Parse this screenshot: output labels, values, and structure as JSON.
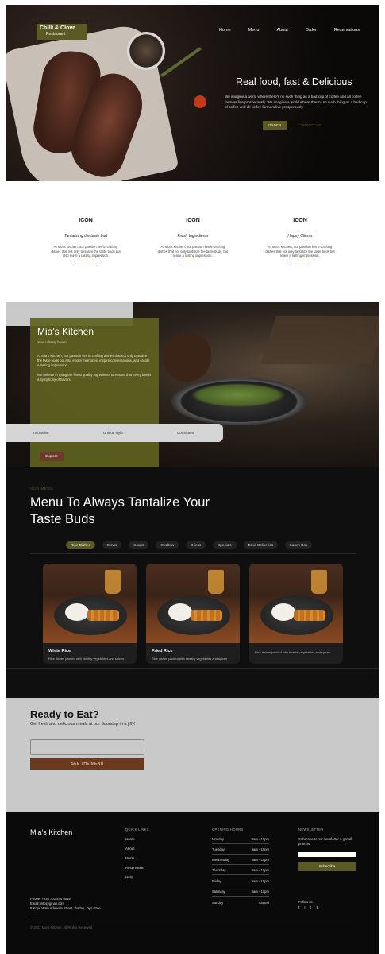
{
  "hero": {
    "brand": "Chilli & Clove",
    "brand_sub": "Restaurant",
    "nav": [
      "Home",
      "Menu",
      "About",
      "Order",
      "Reservations"
    ],
    "title": "Real food, fast & Delicious",
    "lead": "We imagine a world where there's no such thing as a bad cup of coffee and all coffee farmers live prosperously. We imagine a world where there's no such thing as a bad cup of coffee and all coffee farmers live prosperously.",
    "order_label": "ORDER",
    "contact_label": "CONTACT US"
  },
  "features": [
    {
      "icon": "ICON",
      "title": "Tantalizing the taste bud",
      "text": "At Mia's Kitchen, our passion lies in crafting dishes that not only tantalize the taste buds but also leave a lasting impression."
    },
    {
      "icon": "ICON",
      "title": "Fresh Ingredients",
      "text": "At Mia's Kitchen, our passion lies in crafting dishes that not only tantalize the taste buds, but leave a lasting impression."
    },
    {
      "icon": "ICON",
      "title": "Happy Clients",
      "text": "At Mia's Kitchen, our passion lies in crafting dishes that not only tantalize the taste buds but leave a lasting impression."
    }
  ],
  "kitchen": {
    "title": "Mia's Kitchen",
    "tagline": "Your culinary haven",
    "p1": "At Mia's Kitchen, our passion lies in crafting dishes that not only tantalize the taste buds but also evoke memories, inspire conversations, and create a lasting impression.",
    "p2": "We believe in using the finest quality ingredients to ensure that every bite is a symphony of flavors.",
    "strip": [
      "Innovative",
      "Unique style",
      "Consistent"
    ],
    "explore_label": "Explore"
  },
  "menu": {
    "eyebrow": "OUR MENU",
    "title": "Menu To Always Tantalize Your Taste Buds",
    "tabs": [
      "Rice-Dishes",
      "Stews",
      "Soups",
      "Swallow",
      "Drinks",
      "Specials",
      "Bowl-Deliveries",
      "Lunch-Box"
    ],
    "cards": [
      {
        "title": "White Rice",
        "desc": "Rice dishes packed with healthy vegetables and spices"
      },
      {
        "title": "Fried Rice",
        "desc": "Rice dishes packed with healthy vegetables and spices"
      },
      {
        "title": "",
        "desc": "Rice dishes packed with healthy vegetables and spices"
      }
    ]
  },
  "ready": {
    "title": "Ready to Eat?",
    "subtitle": "Get fresh and delicious meals at our doorstep in a jiffy!",
    "input_placeholder": "",
    "button_label": "SEE THE MENU"
  },
  "footer": {
    "brand": "Mia's Kitchen",
    "quick_links_title": "QUICK LINKS",
    "quick_links": [
      "Home",
      "About",
      "Menu",
      "Reservation",
      "Help"
    ],
    "hours_title": "OPENING HOURS",
    "hours": [
      {
        "day": "Monday",
        "time": "9am - 10pm"
      },
      {
        "day": "Tuesday",
        "time": "9am - 10pm"
      },
      {
        "day": "Wednesday",
        "time": "9am - 10pm"
      },
      {
        "day": "Thursday",
        "time": "9am - 10pm"
      },
      {
        "day": "Friday",
        "time": "9am - 10pm"
      },
      {
        "day": "Saturday",
        "time": "9am - 10pm"
      },
      {
        "day": "Sunday",
        "time": "Closed"
      }
    ],
    "newsletter_title": "NEWSLETTER",
    "newsletter_text": "Subscribe to our newsletter & get all promos",
    "subscribe_label": "Subscribe",
    "phone": "Phone: +234 701 444 5556",
    "email": "Email: info@gmail.com",
    "address": "8 Kope Wale Adewale Street, Ibadan, Oyo state",
    "follow_label": "Follow us",
    "social": [
      "f",
      "i",
      "t",
      "Y"
    ],
    "copyright": "© 2022 Mia's Kitchen. All Rights Reserved."
  }
}
